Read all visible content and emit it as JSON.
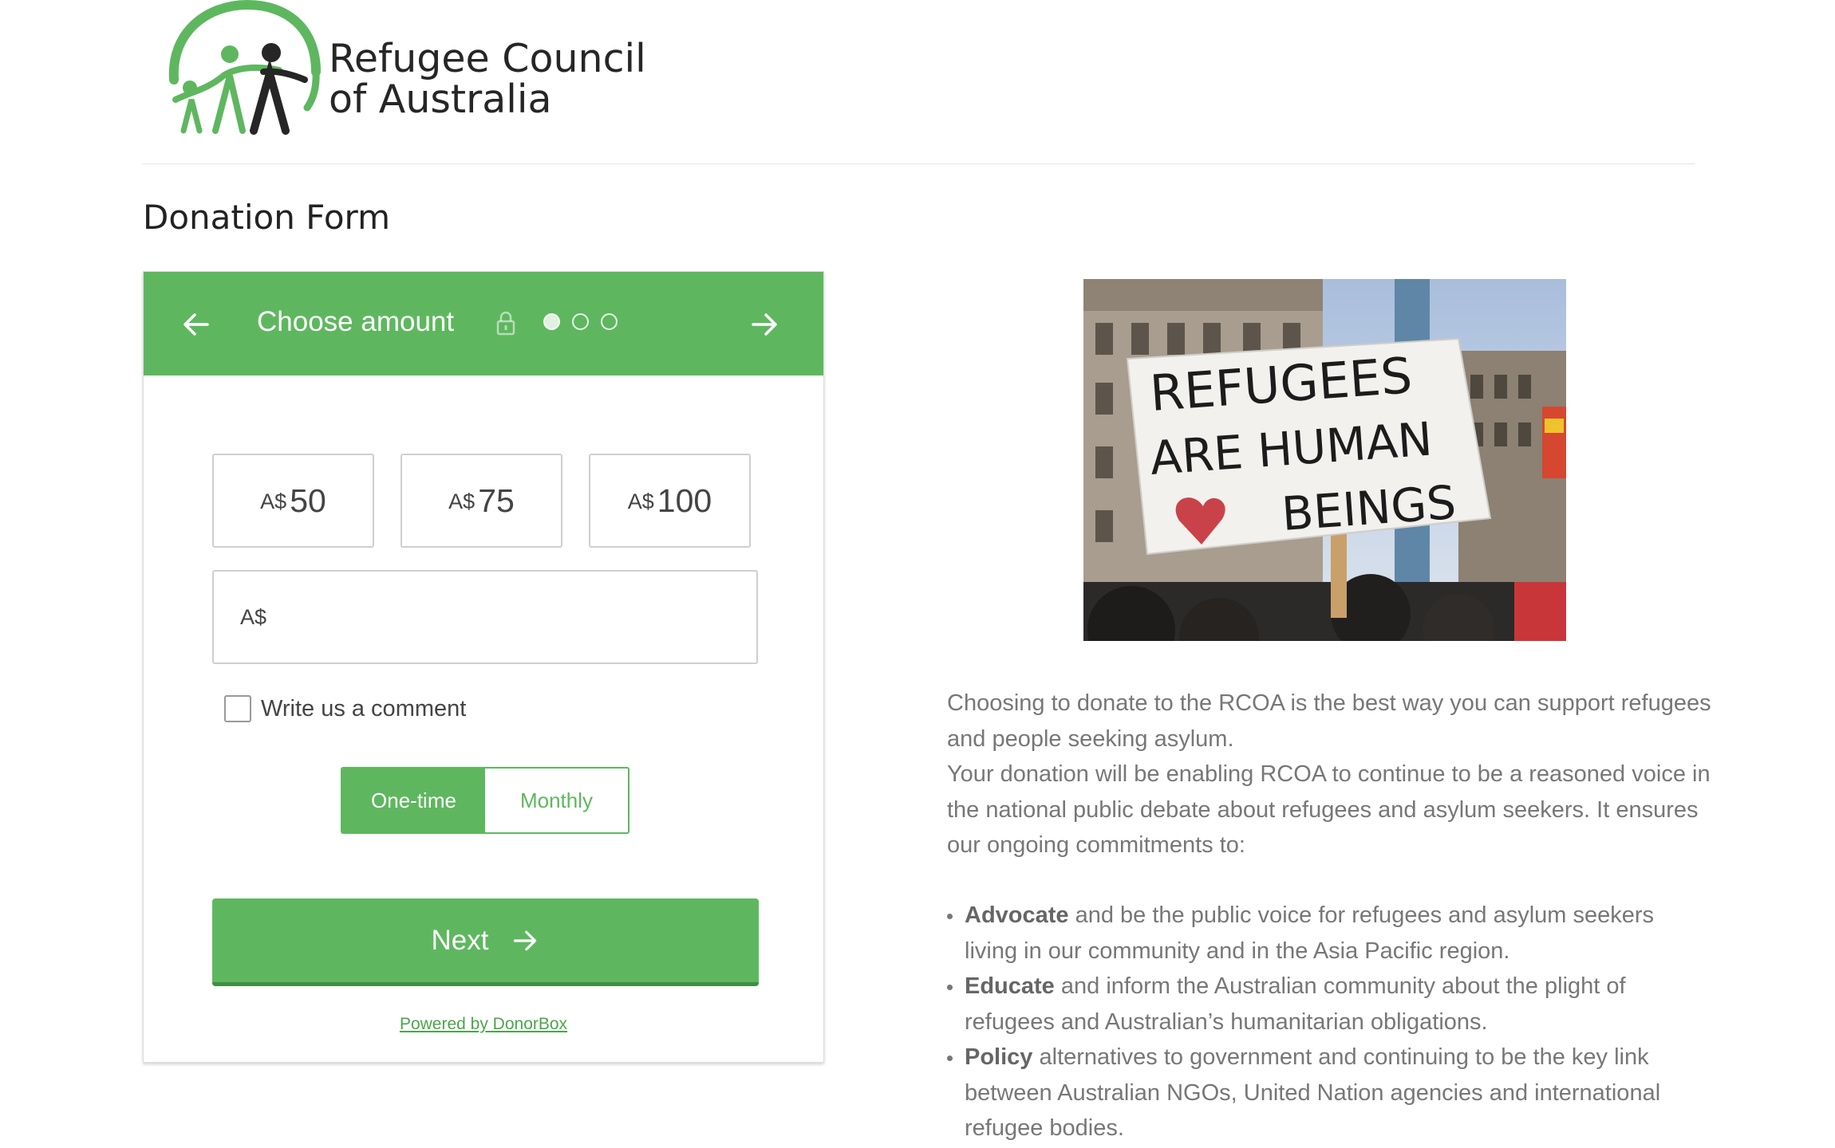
{
  "brand": {
    "name_line1": "Refugee Council",
    "name_line2": "of Australia",
    "green": "#5eb75f",
    "dark": "#262626"
  },
  "page": {
    "title": "Donation Form"
  },
  "widget": {
    "header_title": "Choose amount",
    "back_icon": "arrow-left-icon",
    "next_icon": "arrow-right-icon",
    "lock_icon": "lock-icon",
    "steps_total": 3,
    "step_current": 1,
    "amounts": [
      {
        "currency": "A$",
        "value": "50"
      },
      {
        "currency": "A$",
        "value": "75"
      },
      {
        "currency": "A$",
        "value": "100"
      }
    ],
    "custom_amount": {
      "currency": "A$",
      "value": ""
    },
    "comment_label": "Write us a comment",
    "comment_checked": false,
    "frequency": {
      "options": [
        "One-time",
        "Monthly"
      ],
      "selected": "One-time"
    },
    "next_label": "Next",
    "powered_by": "Powered by DonorBox"
  },
  "photo": {
    "sign_line1": "REFUGEES",
    "sign_line2": "ARE HUMAN",
    "sign_line3": "BEINGS"
  },
  "description": {
    "p1": "Choosing to donate to the RCOA is the best way you can support refugees and people seeking asylum.",
    "p2": "Your donation will be enabling RCOA to continue to be a reasoned voice in the national public debate about refugees and asylum seekers. It ensures our ongoing commitments to:",
    "commitments": [
      {
        "term": "Advocate",
        "text": " and be the public voice for refugees and asylum seekers living in our community and in the Asia Pacific region."
      },
      {
        "term": "Educate",
        "text": " and inform the Australian community about the plight of refugees and Australian’s humanitarian obligations."
      },
      {
        "term": "Policy",
        "text": " alternatives to government and continuing to be the key link between Australian NGOs, United Nation agencies and international refugee bodies."
      }
    ]
  }
}
